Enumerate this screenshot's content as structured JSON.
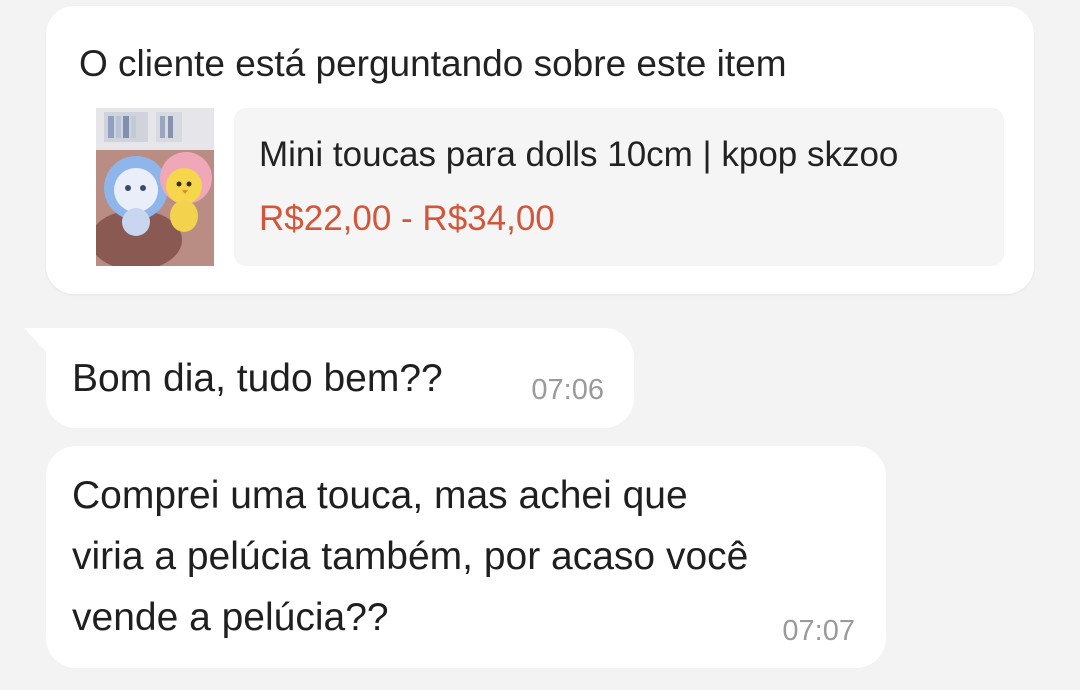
{
  "product_card": {
    "heading": "O cliente está perguntando sobre este item",
    "thumbnail_icon": "plush-dolls-photo",
    "product_name": "Mini toucas para dolls 10cm | kpop skzoo",
    "price_range": "R$22,00 - R$34,00",
    "price_color": "#d3553a"
  },
  "messages": [
    {
      "lines": [
        "Bom dia, tudo bem??"
      ],
      "time": "07:06"
    },
    {
      "lines": [
        "Comprei uma touca, mas achei que",
        "viria a pelúcia também, por acaso você",
        "vende a pelúcia??"
      ],
      "time": "07:07"
    }
  ]
}
